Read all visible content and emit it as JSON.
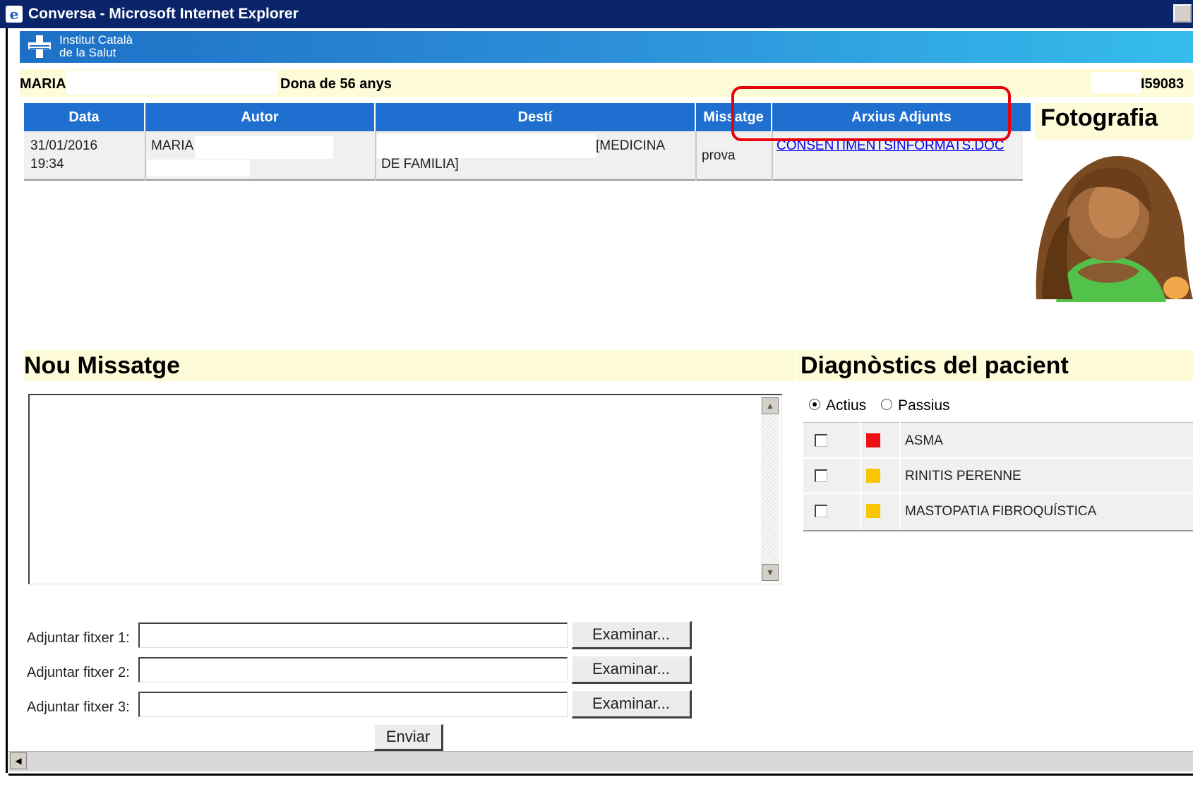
{
  "window": {
    "title": "Conversa - Microsoft Internet Explorer"
  },
  "banner": {
    "org_line1": "Institut Català",
    "org_line2": "de la Salut"
  },
  "patient": {
    "name": "MARIA",
    "description": "Dona de 56 anys",
    "id_suffix": "I59083"
  },
  "messages": {
    "headers": {
      "date": "Data",
      "author": "Autor",
      "destination": "Destí",
      "message": "Missatge",
      "attachments": "Arxius Adjunts"
    },
    "rows": [
      {
        "date": "31/01/2016",
        "time": "19:34",
        "author": "MARIA",
        "destination_line1": "[MEDICINA",
        "destination_line2": "DE FAMILIA]",
        "message": "prova",
        "attachment": "CONSENTIMENTSINFORMATS.DOC"
      }
    ]
  },
  "photo": {
    "title": "Fotografia"
  },
  "new_message": {
    "title": "Nou Missatge",
    "attach_labels": [
      "Adjuntar fitxer 1:",
      "Adjuntar fitxer 2:",
      "Adjuntar fitxer 3:"
    ],
    "browse_label": "Examinar...",
    "send_label": "Enviar"
  },
  "diagnostics": {
    "title": "Diagnòstics del pacient",
    "filter_active": "Actius",
    "filter_passive": "Passius",
    "selected_filter": "Actius",
    "items": [
      {
        "name": "ASMA",
        "severity_color": "#ee1111"
      },
      {
        "name": "RINITIS PERENNE",
        "severity_color": "#f7c600"
      },
      {
        "name": "MASTOPATIA FIBROQUÍSTICA",
        "severity_color": "#f7c600"
      }
    ]
  },
  "colors": {
    "title_bar": "#0a246a",
    "table_header": "#1e6fd0",
    "section_bg": "#fefbd8",
    "highlight": "#e8000b"
  }
}
